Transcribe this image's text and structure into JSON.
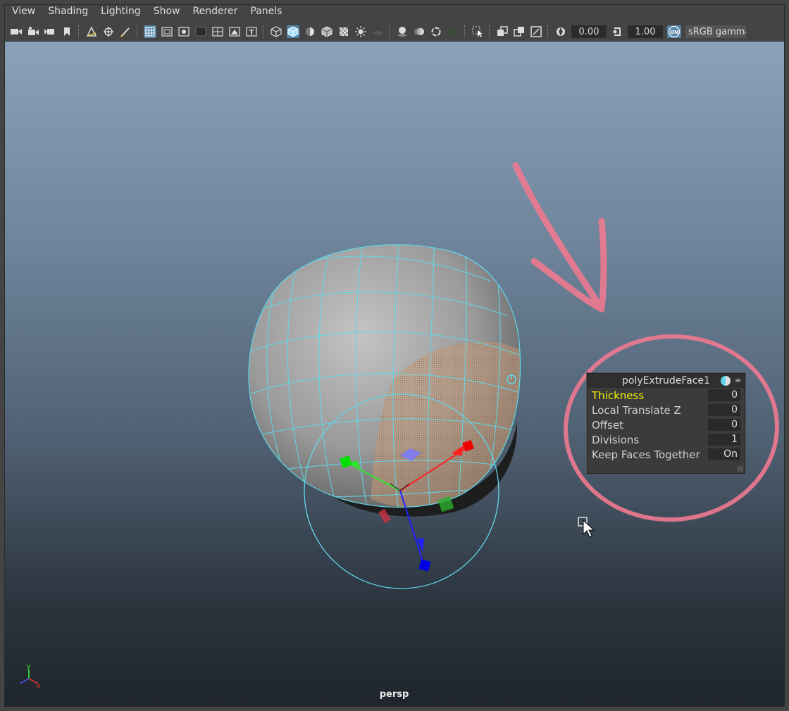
{
  "menu": [
    "View",
    "Shading",
    "Lighting",
    "Show",
    "Renderer",
    "Panels"
  ],
  "toolbar": {
    "field1": "0.00",
    "field2": "1.00",
    "on_label": "ON",
    "colorspace": "sRGB gamma"
  },
  "viewport": {
    "camera_label": "persp",
    "axis_y": "y",
    "axis_x": "x"
  },
  "hud": {
    "title": "polyExtrudeFace1",
    "rows": [
      {
        "label": "Thickness",
        "value": "0"
      },
      {
        "label": "Local Translate Z",
        "value": "0"
      },
      {
        "label": "Offset",
        "value": "0"
      },
      {
        "label": "Divisions",
        "value": "1"
      },
      {
        "label": "Keep Faces Together",
        "value": "On"
      }
    ]
  },
  "colors": {
    "wire": "#5fd8ea",
    "annotation": "#ee7a91",
    "highlight": "#f2f200"
  }
}
